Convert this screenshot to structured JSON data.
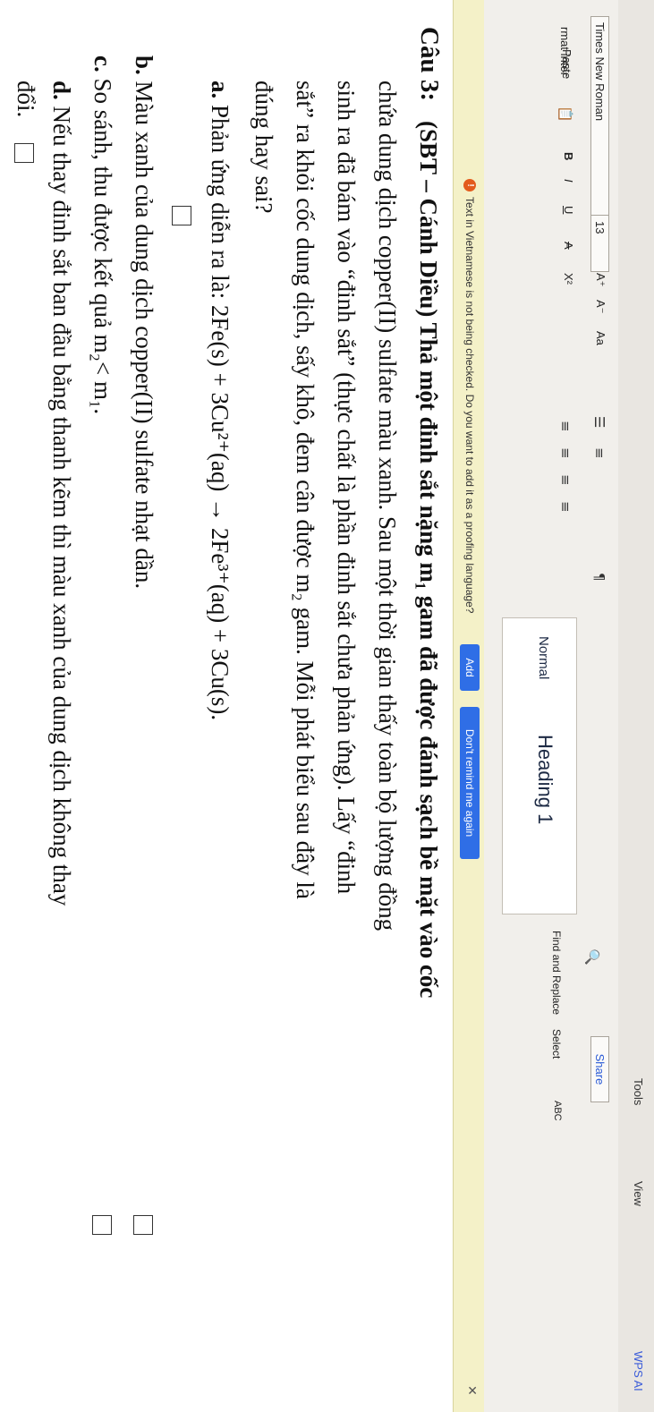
{
  "tabs": [
    "Tools",
    "View",
    "WPS AI"
  ],
  "share_label": "Share",
  "ribbon": {
    "paste_label": "Paste",
    "format_painter_label": "rmat\ninter",
    "font_name": "Times New Roman",
    "font_size": "13",
    "grow_font": "A⁺",
    "shrink_font": "A⁻",
    "change_case": "Aa",
    "bold": "B",
    "italic": "I",
    "underline": "U",
    "strike": "A",
    "superscript": "X²",
    "styles": {
      "normal": "Normal",
      "heading1": "Heading 1"
    },
    "find_replace_label": "Find and Replace",
    "select_label": "Select",
    "spell_label": "ABC"
  },
  "notice": {
    "text": "Text in Vietnamese is not being checked. Do you want to add it as a proofing language?",
    "add_label": "Add",
    "remind_label": "Don't remind me again"
  },
  "document": {
    "q_label": "Câu 3:",
    "line1": "(SBT – Cánh Diều) Thả một đinh sắt nặng m₁ gam đã được đánh sạch bề mặt vào cốc",
    "line2": "chứa dung dịch copper(II) sulfate màu xanh. Sau một thời gian thấy toàn bộ lượng đồng",
    "line3": "sinh ra đã bám vào “đinh sắt” (thực chất là phần đinh sắt chưa phản ứng). Lấy “đinh",
    "line4": "sắt” ra khỏi cốc dung dịch, sấy khô, đem cân được m₂ gam. Mỗi phát biểu sau đây là",
    "line5": "đúng hay sai?",
    "a_label": "a.",
    "a_text": "Phản ứng diễn ra là: 2Fe(s) + 3Cu²⁺(aq) → 2Fe³⁺(aq) + 3Cu(s).",
    "b_label": "b.",
    "b_text": "Màu xanh của dung dịch copper(II) sulfate nhạt dần.",
    "c_label": "c.",
    "c_text": "So sánh, thu được kết quả m₂< m₁.",
    "d_label": "d.",
    "d_text": "Nếu thay đinh sắt ban đầu bằng thanh kẽm thì màu xanh của dung dịch không thay",
    "d_text2": "đổi."
  }
}
